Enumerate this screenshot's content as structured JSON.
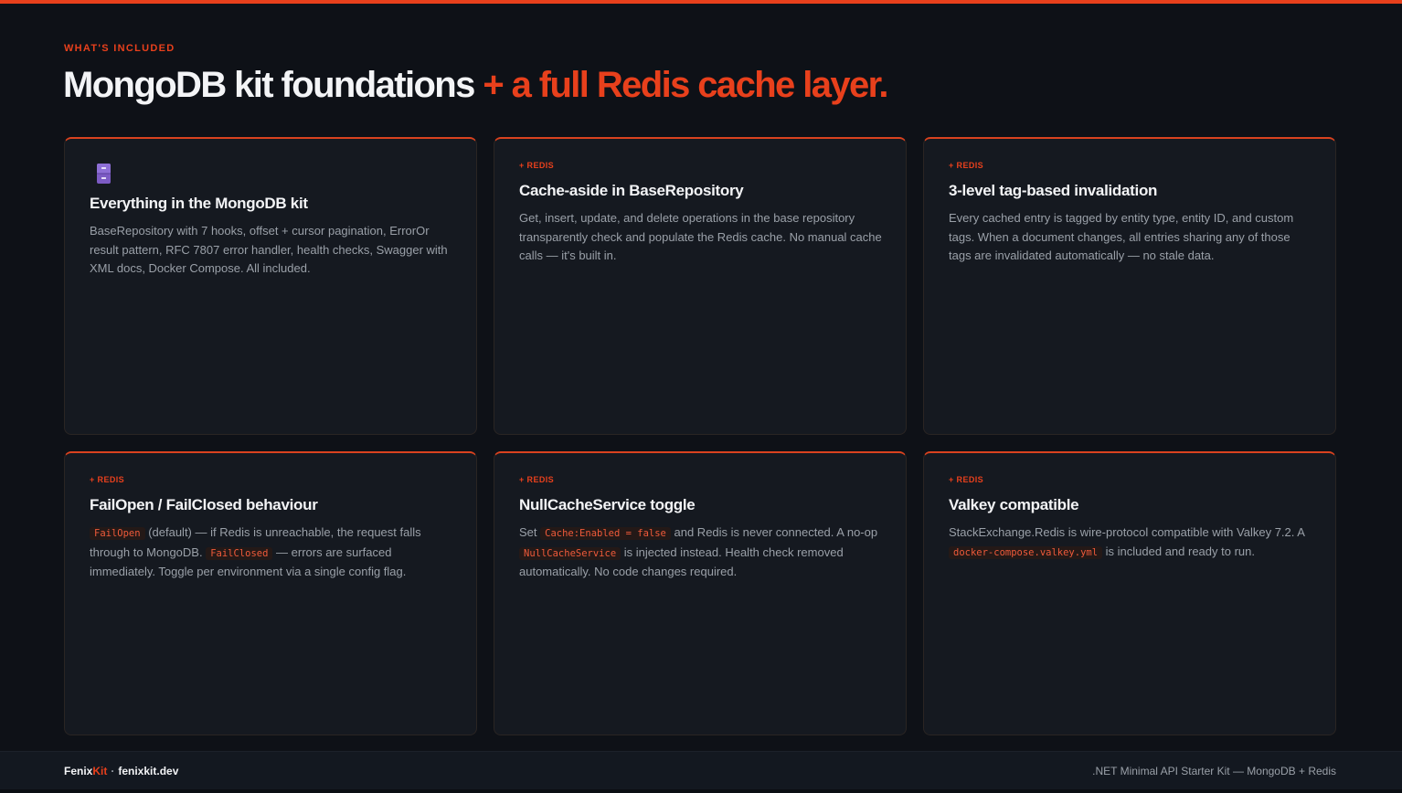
{
  "header": {
    "eyebrow": "WHAT'S INCLUDED",
    "title_main": "MongoDB kit foundations",
    "title_accent": "+ a full Redis cache layer."
  },
  "cards": [
    {
      "icon": "file-cabinet-icon",
      "tag": "",
      "title": "Everything in the MongoDB kit",
      "body": "BaseRepository with 7 hooks, offset + cursor pagination, ErrorOr result pattern, RFC 7807 error handler, health checks, Swagger with XML docs, Docker Compose. All included."
    },
    {
      "tag": "+ REDIS",
      "title": "Cache-aside in BaseRepository",
      "body": "Get, insert, update, and delete operations in the base repository transparently check and populate the Redis cache. No manual cache calls — it's built in."
    },
    {
      "tag": "+ REDIS",
      "title": "3-level tag-based invalidation",
      "body": "Every cached entry is tagged by entity type, entity ID, and custom tags. When a document changes, all entries sharing any of those tags are invalidated automatically — no stale data."
    },
    {
      "tag": "+ REDIS",
      "title": "FailOpen / FailClosed behaviour",
      "body_parts": {
        "code1": "FailOpen",
        "text1": " (default) — if Redis is unreachable, the request falls through to MongoDB. ",
        "code2": "FailClosed",
        "text2": " — errors are surfaced immediately. Toggle per environment via a single config flag."
      }
    },
    {
      "tag": "+ REDIS",
      "title": "NullCacheService toggle",
      "body_parts": {
        "text0": "Set ",
        "code1": "Cache:Enabled = false",
        "text1": " and Redis is never connected. A no-op ",
        "code2": "NullCacheService",
        "text2": " is injected instead. Health check removed automatically. No code changes required."
      }
    },
    {
      "tag": "+ REDIS",
      "title": "Valkey compatible",
      "body_parts": {
        "text0": "StackExchange.Redis is wire-protocol compatible with Valkey 7.2. A ",
        "code1": "docker-compose.valkey.yml",
        "text1": " is included and ready to run."
      }
    }
  ],
  "footer": {
    "brand_a": "Fenix",
    "brand_b": "Kit",
    "separator": "·",
    "domain": "fenixkit.dev",
    "tagline": ".NET Minimal API Starter Kit — MongoDB + Redis"
  },
  "colors": {
    "accent": "#e8401c",
    "background": "#0e1117",
    "card": "#151920"
  }
}
